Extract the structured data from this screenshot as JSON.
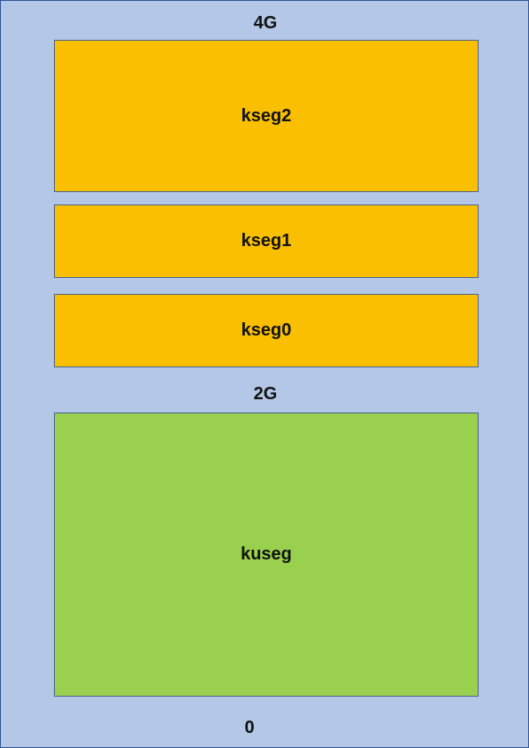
{
  "addresses": {
    "top": "4G",
    "middle": "2G",
    "bottom": "0"
  },
  "segments": {
    "kseg2": "kseg2",
    "kseg1": "kseg1",
    "kseg0": "kseg0",
    "kuseg": "kuseg"
  },
  "colors": {
    "background": "#b4c7e7",
    "kernel_segment": "#f9bf00",
    "user_segment": "#99d04d"
  }
}
